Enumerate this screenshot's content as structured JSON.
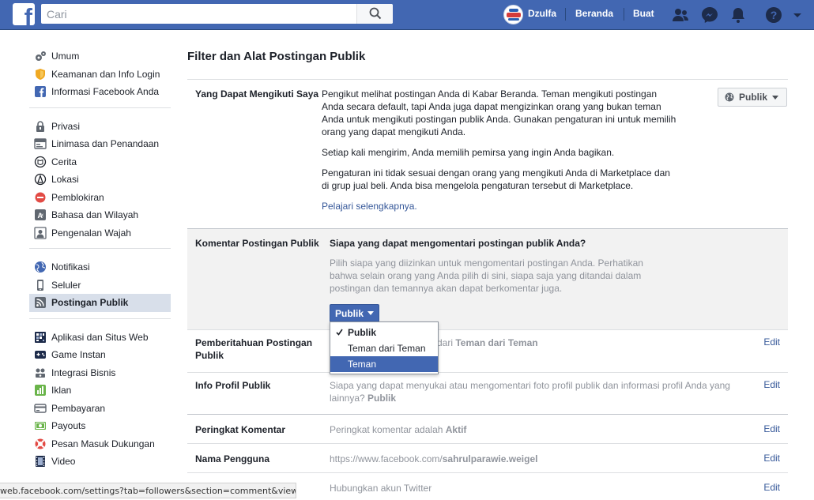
{
  "topbar": {
    "search_placeholder": "Cari",
    "user_name": "Dzulfa",
    "home_label": "Beranda",
    "create_label": "Buat"
  },
  "sidebar": {
    "groups": [
      [
        {
          "label": "Umum",
          "icon": "gears-icon"
        },
        {
          "label": "Keamanan dan Info Login",
          "icon": "shield-icon"
        },
        {
          "label": "Informasi Facebook Anda",
          "icon": "facebook-icon"
        }
      ],
      [
        {
          "label": "Privasi",
          "icon": "lock-icon"
        },
        {
          "label": "Linimasa dan Penandaan",
          "icon": "timeline-icon"
        },
        {
          "label": "Cerita",
          "icon": "book-icon"
        },
        {
          "label": "Lokasi",
          "icon": "location-icon"
        },
        {
          "label": "Pemblokiran",
          "icon": "block-icon"
        },
        {
          "label": "Bahasa dan Wilayah",
          "icon": "language-icon"
        },
        {
          "label": "Pengenalan Wajah",
          "icon": "face-icon"
        }
      ],
      [
        {
          "label": "Notifikasi",
          "icon": "globe-icon"
        },
        {
          "label": "Seluler",
          "icon": "mobile-icon"
        },
        {
          "label": "Postingan Publik",
          "icon": "rss-icon",
          "active": true
        }
      ],
      [
        {
          "label": "Aplikasi dan Situs Web",
          "icon": "apps-icon"
        },
        {
          "label": "Game Instan",
          "icon": "game-icon"
        },
        {
          "label": "Integrasi Bisnis",
          "icon": "business-icon"
        },
        {
          "label": "Iklan",
          "icon": "ads-icon"
        },
        {
          "label": "Pembayaran",
          "icon": "card-icon"
        },
        {
          "label": "Payouts",
          "icon": "money-icon"
        },
        {
          "label": "Pesan Masuk Dukungan",
          "icon": "support-icon"
        },
        {
          "label": "Video",
          "icon": "film-icon"
        }
      ]
    ]
  },
  "main": {
    "title": "Filter dan Alat Postingan Publik",
    "followers": {
      "label": "Yang Dapat Mengikuti Saya",
      "paragraphs": [
        "Pengikut melihat postingan Anda di Kabar Beranda. Teman mengikuti postingan Anda secara default, tapi Anda juga dapat mengizinkan orang yang bukan teman Anda untuk mengikuti postingan publik Anda. Gunakan pengaturan ini untuk memilih orang yang dapat mengikuti Anda.",
        "Setiap kali mengirim, Anda memilih pemirsa yang ingin Anda bagikan.",
        "Pengaturan ini tidak sesuai dengan orang yang mengikuti Anda di Marketplace dan di grup jual beli. Anda bisa mengelola pengaturan tersebut di Marketplace."
      ],
      "learn_more": "Pelajari selengkapnya.",
      "audience_button": "Publik"
    },
    "comments": {
      "label": "Komentar Postingan Publik",
      "question": "Siapa yang dapat mengomentari postingan publik Anda?",
      "description": "Pilih siapa yang diizinkan untuk mengomentari postingan Anda. Perhatikan bahwa selain orang yang Anda pilih di sini, siapa saja yang ditandai dalam postingan dan temannya akan dapat berkomentar juga.",
      "button_label": "Publik",
      "options": [
        "Publik",
        "Teman dari Teman",
        "Teman"
      ],
      "selected": "Publik"
    },
    "notifications": {
      "label": "Pemberitahuan Postingan Publik",
      "desc_prefix": "dari",
      "desc_value": "Teman dari Teman",
      "edit": "Edit"
    },
    "profile_info": {
      "label": "Info Profil Publik",
      "desc": "Siapa yang dapat menyukai atau mengomentari foto profil publik dan informasi profil Anda yang lainnya?",
      "desc_value": "Publik",
      "edit": "Edit"
    },
    "comment_ranking": {
      "label": "Peringkat Komentar",
      "desc": "Peringkat komentar adalah",
      "desc_value": "Aktif",
      "edit": "Edit"
    },
    "username": {
      "label": "Nama Pengguna",
      "url_prefix": "https://www.facebook.com/",
      "url_value": "sahrulparawie.weigel",
      "edit": "Edit"
    },
    "twitter": {
      "desc": "Hubungkan akun Twitter",
      "edit": "Edit"
    }
  },
  "statusbar": {
    "url": "web.facebook.com/settings?tab=followers&section=comment&view#"
  },
  "colors": {
    "brand": "#4267b2",
    "link": "#365899",
    "active_bg": "#d8dfea"
  }
}
